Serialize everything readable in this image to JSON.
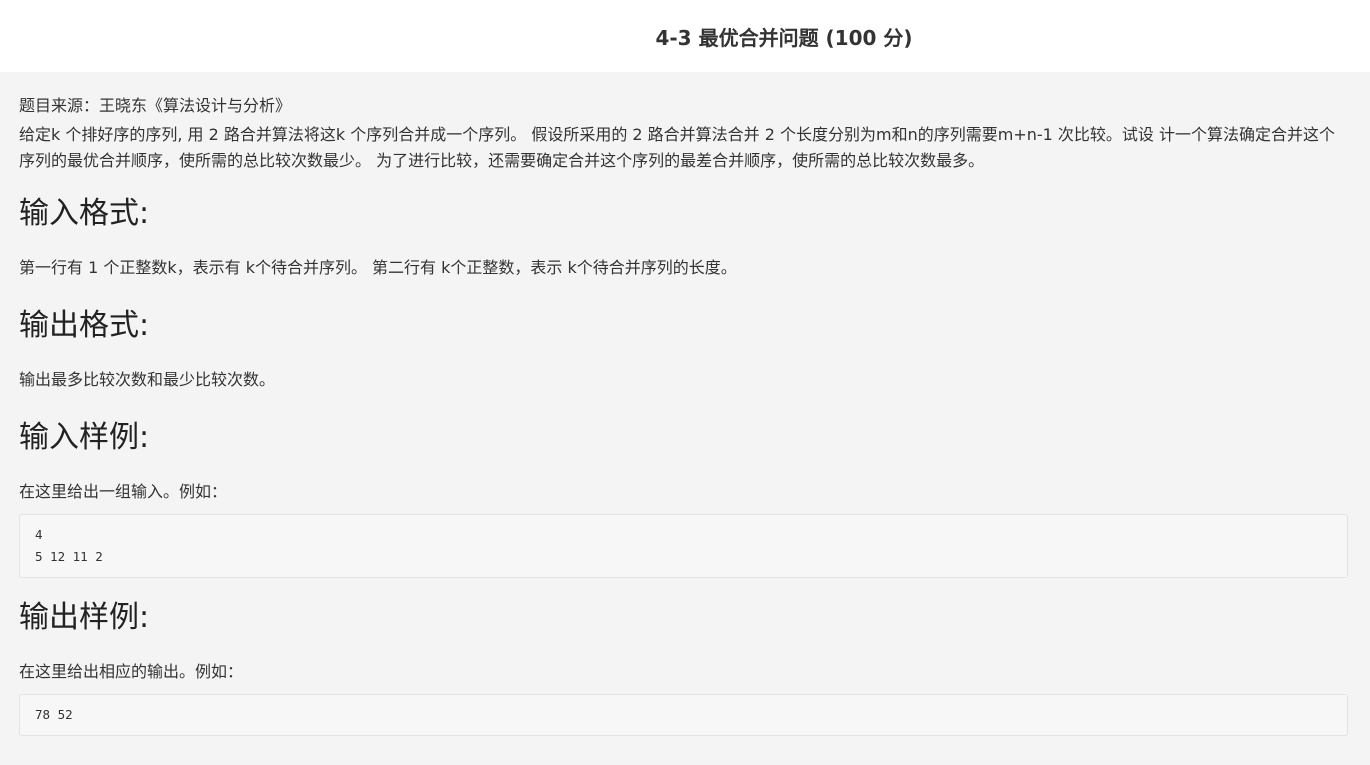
{
  "header": {
    "title": "4-3 最优合并问题 (100 分)"
  },
  "problem": {
    "source": "题目来源：王晓东《算法设计与分析》",
    "description": "给定k 个排好序的序列, 用 2 路合并算法将这k 个序列合并成一个序列。 假设所采用的 2 路合并算法合并 2 个长度分别为m和n的序列需要m+n-1 次比较。试设 计一个算法确定合并这个序列的最优合并顺序，使所需的总比较次数最少。 为了进行比较，还需要确定合并这个序列的最差合并顺序，使所需的总比较次数最多。",
    "input_format": {
      "heading": "输入格式:",
      "text": "第一行有 1 个正整数k，表示有 k个待合并序列。 第二行有 k个正整数，表示 k个待合并序列的长度。"
    },
    "output_format": {
      "heading": "输出格式:",
      "text": "输出最多比较次数和最少比较次数。"
    },
    "sample_input": {
      "heading": "输入样例:",
      "intro": "在这里给出一组输入。例如：",
      "code": "4\n5 12 11 2"
    },
    "sample_output": {
      "heading": "输出样例:",
      "intro": "在这里给出相应的输出。例如：",
      "code": "78 52"
    }
  }
}
